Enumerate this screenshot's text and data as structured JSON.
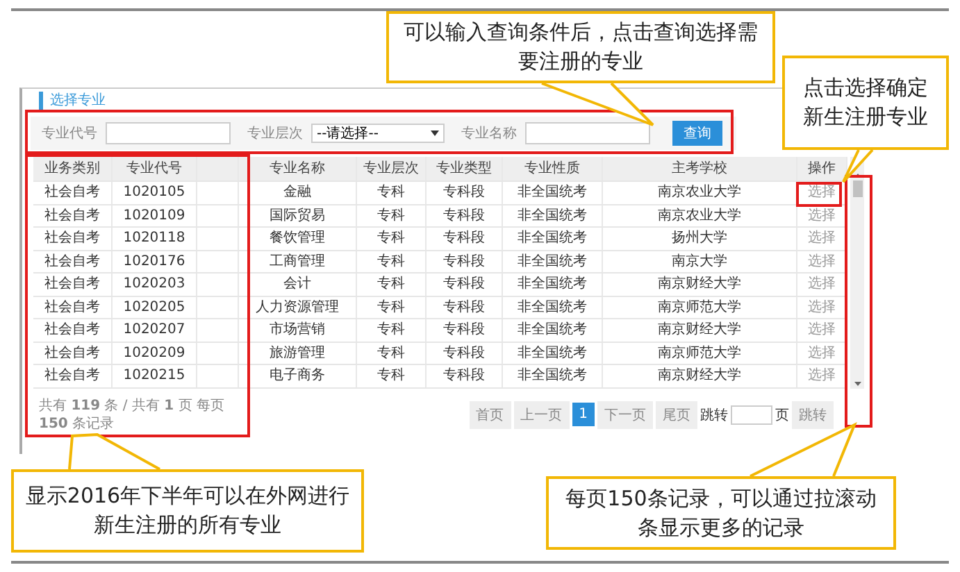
{
  "panel": {
    "title": "选择专业",
    "filters": [
      {
        "label": "专业代号",
        "kind": "text"
      },
      {
        "label": "专业层次",
        "kind": "select",
        "value": "--请选择--"
      },
      {
        "label": "专业名称",
        "kind": "text"
      }
    ],
    "search_button": "查询"
  },
  "table": {
    "columns": [
      "业务类别",
      "专业代号",
      "专业名称",
      "专业层次",
      "专业类型",
      "专业性质",
      "主考学校",
      "操作"
    ],
    "rows": [
      {
        "cells": [
          "社会自考",
          "1020105",
          "金融",
          "专科",
          "专科段",
          "非全国统考",
          "南京农业大学"
        ],
        "action": "选择"
      },
      {
        "cells": [
          "社会自考",
          "1020109",
          "国际贸易",
          "专科",
          "专科段",
          "非全国统考",
          "南京农业大学"
        ],
        "action": "选择"
      },
      {
        "cells": [
          "社会自考",
          "1020118",
          "餐饮管理",
          "专科",
          "专科段",
          "非全国统考",
          "扬州大学"
        ],
        "action": "选择"
      },
      {
        "cells": [
          "社会自考",
          "1020176",
          "工商管理",
          "专科",
          "专科段",
          "非全国统考",
          "南京大学"
        ],
        "action": "选择"
      },
      {
        "cells": [
          "社会自考",
          "1020203",
          "会计",
          "专科",
          "专科段",
          "非全国统考",
          "南京财经大学"
        ],
        "action": "选择"
      },
      {
        "cells": [
          "社会自考",
          "1020205",
          "人力资源管理",
          "专科",
          "专科段",
          "非全国统考",
          "南京师范大学"
        ],
        "action": "选择"
      },
      {
        "cells": [
          "社会自考",
          "1020207",
          "市场营销",
          "专科",
          "专科段",
          "非全国统考",
          "南京财经大学"
        ],
        "action": "选择"
      },
      {
        "cells": [
          "社会自考",
          "1020209",
          "旅游管理",
          "专科",
          "专科段",
          "非全国统考",
          "南京师范大学"
        ],
        "action": "选择"
      },
      {
        "cells": [
          "社会自考",
          "1020215",
          "电子商务",
          "专科",
          "专科段",
          "非全国统考",
          "南京财经大学"
        ],
        "action": "选择"
      }
    ]
  },
  "summary": "共有 **119** 条 / 共有 **1** 页 每页 **150** 条记录",
  "pagination": {
    "pages": [
      {
        "label": "首页",
        "selected": false
      },
      {
        "label": "上一页",
        "selected": false
      },
      {
        "label": "1",
        "selected": true
      },
      {
        "label": "下一页",
        "selected": false
      },
      {
        "label": "尾页",
        "selected": false
      }
    ],
    "jump_label": "跳转",
    "page_unit": "页",
    "jump_button": "跳转"
  },
  "annotations": [
    {
      "text": "可以输入查询条件后，点击查询选择需要注册的专业"
    },
    {
      "text": "点击选择确定新生注册专业"
    },
    {
      "text": "显示2016年下半年可以在外网进行新生注册的所有专业"
    },
    {
      "text": "每页150条记录，可以通过拉滚动条显示更多的记录"
    }
  ]
}
